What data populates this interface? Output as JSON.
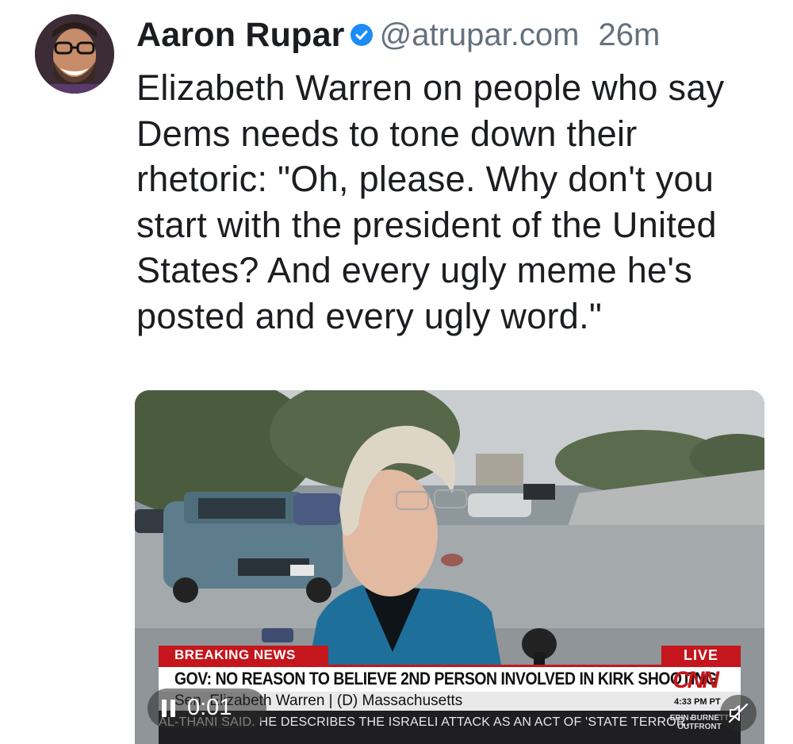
{
  "post": {
    "author_name": "Aaron Rupar",
    "handle": "@atrupar.com",
    "time_ago": "26m",
    "text": "Elizabeth Warren on people who say Dems needs to tone down their rhetoric: \"Oh, please. Why don't you start with the president of the United States? And every ugly meme he's posted and every ugly word.\""
  },
  "video": {
    "chyron": {
      "breaking_label": "BREAKING NEWS",
      "live_label": "LIVE",
      "headline": "GOV: NO REASON TO BELIEVE 2ND PERSON INVOLVED IN KIRK SHOOTING",
      "network_logo": "CNN",
      "guest": "Sen. Elizabeth Warren  |  (D) Massachusetts",
      "clock": "4:33 PM PT",
      "ticker": "AL-THANI SAID. HE DESCRIBES THE ISRAELI ATTACK AS AN ACT OF 'STATE TERROR.'",
      "show_name": "ERIN BURNETT OUTFRONT"
    },
    "timecode": "0:01",
    "play_state": "playing",
    "mute_icon": "speaker-muted-icon"
  },
  "colors": {
    "verified_badge": "#1d8cf8",
    "handle_gray": "#64707d",
    "cnn_red": "#c4161c"
  }
}
